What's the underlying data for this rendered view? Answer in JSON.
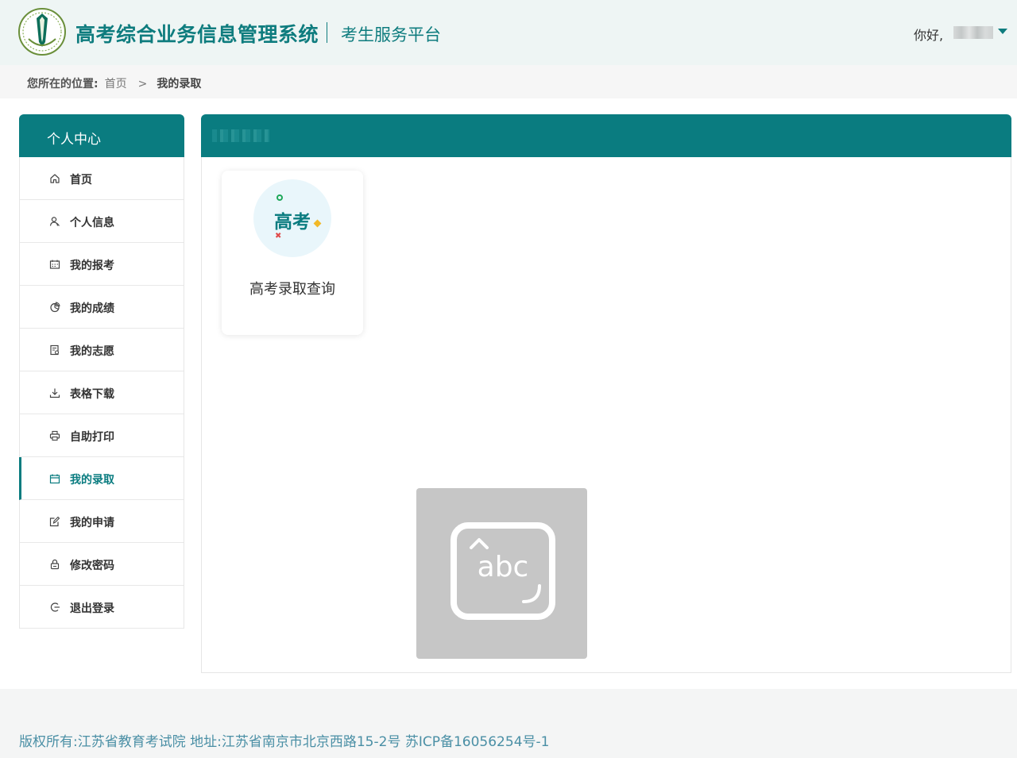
{
  "header": {
    "system_title": "高考综合业务信息管理系统",
    "sub_title": "考生服务平台",
    "greeting": "你好,"
  },
  "breadcrumb": {
    "label": "您所在的位置:",
    "home": "首页",
    "separator": ">",
    "current": "我的录取"
  },
  "sidebar": {
    "title": "个人中心",
    "active_index": 7,
    "items": [
      {
        "label": "首页",
        "icon": "home-icon"
      },
      {
        "label": "个人信息",
        "icon": "user-icon"
      },
      {
        "label": "我的报考",
        "icon": "calendar-icon"
      },
      {
        "label": "我的成绩",
        "icon": "pie-chart-icon"
      },
      {
        "label": "我的志愿",
        "icon": "document-icon"
      },
      {
        "label": "表格下载",
        "icon": "download-icon"
      },
      {
        "label": "自助打印",
        "icon": "printer-icon"
      },
      {
        "label": "我的录取",
        "icon": "calendar-check-icon"
      },
      {
        "label": "我的申请",
        "icon": "edit-icon"
      },
      {
        "label": "修改密码",
        "icon": "lock-icon"
      },
      {
        "label": "退出登录",
        "icon": "logout-icon"
      }
    ]
  },
  "main": {
    "card": {
      "icon_text": "高考",
      "title": "高考录取查询"
    },
    "ime_placeholder": "abc"
  },
  "footer": {
    "text": "版权所有:江苏省教育考试院 地址:江苏省南京市北京西路15-2号 苏ICP备16056254号-1"
  },
  "colors": {
    "brand": "#0a7c80",
    "footer_text": "#4a8fa5"
  }
}
